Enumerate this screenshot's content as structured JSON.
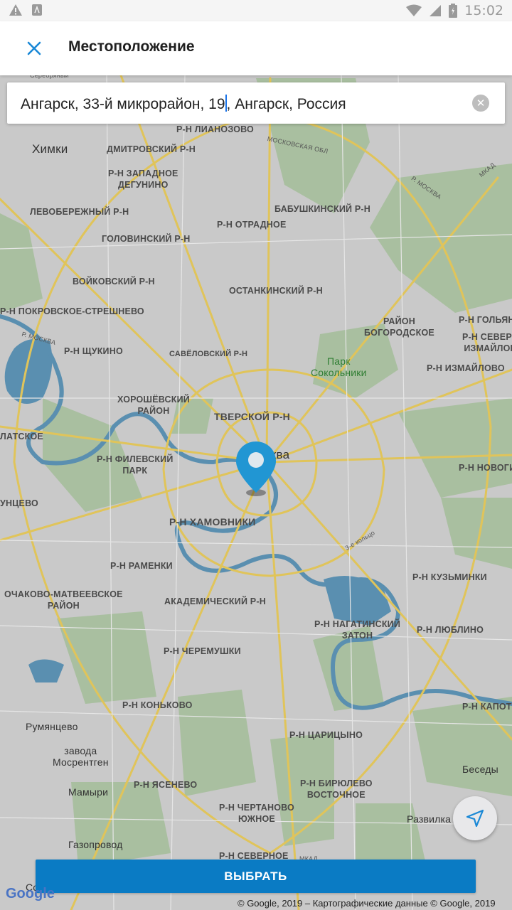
{
  "status_bar": {
    "time": "15:02",
    "icons": [
      "warning-icon",
      "notification-icon",
      "wifi-icon",
      "signal-icon",
      "battery-icon"
    ]
  },
  "app_bar": {
    "title": "Местоположение",
    "close_icon": "close-icon"
  },
  "search": {
    "value_before_caret": "Ангарск, 33-й микрорайон, 19",
    "value_after_caret": ", Ангарск, Россия",
    "clear_icon": "clear-icon"
  },
  "map": {
    "labels": [
      {
        "id": "serebryanyi",
        "text": "Серебряный"
      },
      {
        "id": "lianozovo",
        "text": "Р-Н ЛИАНОЗОВО"
      },
      {
        "id": "mosobl",
        "text": "МОСКОВСКАЯ ОБЛ"
      },
      {
        "id": "khimki",
        "text": "Химки"
      },
      {
        "id": "dmitrovsky",
        "text": "ДМИТРОВСКИЙ Р-Н"
      },
      {
        "id": "zapdegunino",
        "text": "Р-Н ЗАПАДНОЕ\nДЕГУНИНО"
      },
      {
        "id": "mkad-top",
        "text": "МКАД"
      },
      {
        "id": "moskva-river-top",
        "text": "Р. МОСКВА"
      },
      {
        "id": "babushkinsky",
        "text": "БАБУШКИНСКИЙ Р-Н"
      },
      {
        "id": "levoberezhny",
        "text": "ЛЕВОБЕРЕЖНЫЙ Р-Н"
      },
      {
        "id": "otradnoe",
        "text": "Р-Н ОТРАДНОЕ"
      },
      {
        "id": "golovinsky",
        "text": "ГОЛОВИНСКИЙ Р-Н"
      },
      {
        "id": "voykovsky",
        "text": "ВОЙКОВСКИЙ Р-Н"
      },
      {
        "id": "ostankinsky",
        "text": "ОСТАНКИНСКИЙ Р-Н"
      },
      {
        "id": "pokrovskoe",
        "text": "Р-Н ПОКРОВСКОЕ-СТРЕШНЕВО"
      },
      {
        "id": "bogorodskoe",
        "text": "РАЙОН\nБОГОРОДСКОЕ"
      },
      {
        "id": "golyanovo",
        "text": "Р-Н ГОЛЬЯНО"
      },
      {
        "id": "sevizmaylovo",
        "text": "Р-Н СЕВЕРН\nИЗМАЙЛОВ"
      },
      {
        "id": "moskva-river-left",
        "text": "Р. МОСКВА"
      },
      {
        "id": "schukino",
        "text": "Р-Н ЩУКИНО"
      },
      {
        "id": "savelovsky",
        "text": "САВЁЛОВСКИЙ Р-Н"
      },
      {
        "id": "park-sokolniki",
        "text": "Парк\nСокольники"
      },
      {
        "id": "izmaylovo",
        "text": "Р-Н ИЗМАЙЛОВО"
      },
      {
        "id": "khoroshevsky",
        "text": "ХОРОШЁВСКИЙ\nРАЙОН"
      },
      {
        "id": "tverskoy",
        "text": "ТВЕРСКОЙ Р-Н"
      },
      {
        "id": "krylatskoe",
        "text": "ЛАТСКОЕ"
      },
      {
        "id": "moskva-city",
        "text": "Москва"
      },
      {
        "id": "filevsky",
        "text": "Р-Н ФИЛЕВСКИЙ\nПАРК"
      },
      {
        "id": "novogireevo",
        "text": "Р-Н НОВОГИ"
      },
      {
        "id": "kuntsevo",
        "text": "УНЦЕВО"
      },
      {
        "id": "khamovniki",
        "text": "Р-Н ХАМОВНИКИ"
      },
      {
        "id": "ring3",
        "text": "3-е кольцо"
      },
      {
        "id": "ramenki",
        "text": "Р-Н РАМЕНКИ"
      },
      {
        "id": "kuzminki",
        "text": "Р-Н КУЗЬМИНКИ"
      },
      {
        "id": "ochakovo",
        "text": "ОЧАКОВО-МАТВЕЕВСКОЕ\nРАЙОН"
      },
      {
        "id": "akademichesky",
        "text": "АКАДЕМИЧЕСКИЙ Р-Н"
      },
      {
        "id": "nagatinsky",
        "text": "Р-Н НАГАТИНСКИЙ\nЗАТОН"
      },
      {
        "id": "lyublino",
        "text": "Р-Н ЛЮБЛИНО"
      },
      {
        "id": "cheremushki",
        "text": "Р-Н ЧЕРЕМУШКИ"
      },
      {
        "id": "konkovo",
        "text": "Р-Н КОНЬКОВО"
      },
      {
        "id": "kapotnya",
        "text": "Р-Н КАПОТ"
      },
      {
        "id": "rumyantsevo",
        "text": "Румянцево"
      },
      {
        "id": "tsaritsyno",
        "text": "Р-Н ЦАРИЦЫНО"
      },
      {
        "id": "zavod",
        "text": "завода\nМосрентген"
      },
      {
        "id": "besedy",
        "text": "Беседы"
      },
      {
        "id": "mamyri",
        "text": "Мамыри"
      },
      {
        "id": "yasenevo",
        "text": "Р-Н ЯСЕНЕВО"
      },
      {
        "id": "biryulevo",
        "text": "Р-Н БИРЮЛЕВО\nВОСТОЧНОЕ"
      },
      {
        "id": "chertanovo",
        "text": "Р-Н ЧЕРТАНОВО\nЮЖНОЕ"
      },
      {
        "id": "razvilka",
        "text": "Развилка"
      },
      {
        "id": "gazoprovod",
        "text": "Газопровод"
      },
      {
        "id": "severnoe",
        "text": "Р-Н СЕВЕРНОЕ"
      },
      {
        "id": "mkad-bottom",
        "text": "МКАД"
      },
      {
        "id": "sosenskoe",
        "text": "Со"
      }
    ]
  },
  "locate_button": {
    "icon": "navigation-arrow-icon"
  },
  "select_button": {
    "label": "ВЫБРАТЬ"
  },
  "google_logo": "Google",
  "attribution": "© Google, 2019 – Картографические данные © Google, 2019",
  "colors": {
    "accent": "#0a7bc4",
    "pin": "#2196d3",
    "map_bg": "#c9c9c9",
    "road": "#e0c45a",
    "water": "#5a8fb0",
    "park": "#a9bfa0"
  }
}
